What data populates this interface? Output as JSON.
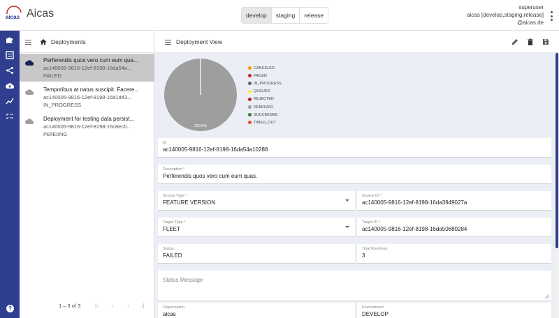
{
  "header": {
    "logo_text": "aicas",
    "app_title": "Aicas",
    "environments": [
      {
        "label": "develop",
        "active": true
      },
      {
        "label": "staging",
        "active": false
      },
      {
        "label": "release",
        "active": false
      }
    ],
    "user": {
      "name": "superuser",
      "scope": "aicas [develop,staging,release]",
      "domain": "@aicas.de"
    }
  },
  "rail": {
    "icons": [
      "puzzle-icon",
      "list-alt-icon",
      "flow-icon",
      "cloud-upload-icon",
      "chart-icon",
      "checklist-icon"
    ],
    "help_label": "?"
  },
  "deployments": {
    "title": "Deployments",
    "items": [
      {
        "title": "Perferendis quos vero cum eum qua...",
        "id": "ac140005-9816-12ef-8198-16da54a...",
        "status": "FAILED",
        "selected": true
      },
      {
        "title": "Temporibus at natus suscipit. Facere...",
        "id": "ac140005-9816-12ef-8198-16d1d43...",
        "status": "IN_PROGRESS",
        "selected": false
      },
      {
        "title": "Deployment for testing data persist...",
        "id": "ac140005-9816-12ef-8198-16c8ecb...",
        "status": "PENDING",
        "selected": false
      }
    ],
    "pager": {
      "range": "1 – 3 of 3"
    }
  },
  "view": {
    "title": "Deployment View",
    "actions": [
      "edit-icon",
      "delete-icon",
      "save-icon"
    ]
  },
  "chart_data": {
    "type": "pie",
    "categories": [
      "CANCELED",
      "FAILED",
      "IN_PROGRESS",
      "QUEUED",
      "REJECTED",
      "REMOVED",
      "SUCCEEDED",
      "TIMED_OUT"
    ],
    "values": [
      0,
      1,
      0,
      0,
      0,
      0,
      0,
      0
    ],
    "colors": [
      "#ff9800",
      "#c62828",
      "#616161",
      "#ffeb3b",
      "#b71c1c",
      "#9e9e9e",
      "#2e7d32",
      "#f44336"
    ],
    "slice_color": "#9e9e9e",
    "data_label": "100.0%",
    "legend_position": "right"
  },
  "form": {
    "id": {
      "label": "Id",
      "value": "ac140005-9816-12ef-8198-16da54a10288"
    },
    "description": {
      "label": "Description *",
      "value": "Perferendis quos vero cum eum quas."
    },
    "source_type": {
      "label": "Source Type *",
      "value": "FEATURE VERSION"
    },
    "source_id": {
      "label": "Source ID *",
      "value": "ac140005-9816-12ef-8198-16da3949027a"
    },
    "target_type": {
      "label": "Target Type *",
      "value": "FLEET"
    },
    "target_id": {
      "label": "Target ID *",
      "value": "ac140005-9816-12ef-8198-16da50680284"
    },
    "status": {
      "label": "Status",
      "value": "FAILED"
    },
    "total_runtimes": {
      "label": "Total Runtimes",
      "value": "3"
    },
    "status_message": {
      "placeholder": "Status Message"
    },
    "organization": {
      "label": "Organization",
      "value": "aicas"
    },
    "environment": {
      "label": "Environment",
      "value": "DEVELOP"
    }
  }
}
